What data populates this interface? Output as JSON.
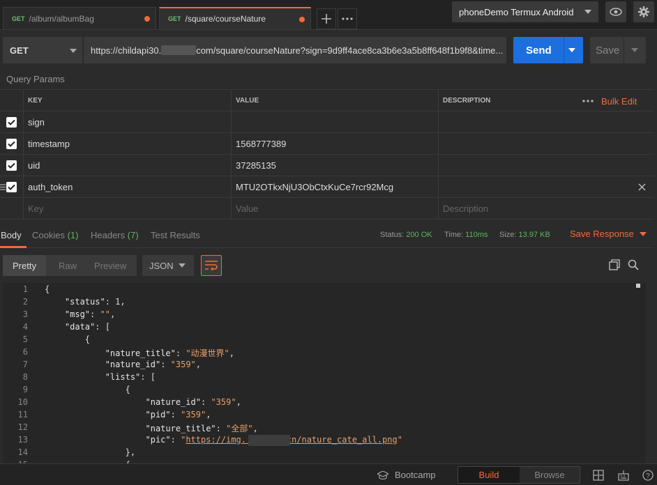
{
  "tabs": [
    {
      "method": "GET",
      "label": "/album/albumBag",
      "unsaved": true
    },
    {
      "method": "GET",
      "label": "/square/courseNature",
      "unsaved": true,
      "active": true
    }
  ],
  "environment": "phoneDemo Termux Android",
  "request": {
    "method": "GET",
    "url_prefix": "https://childapi30.",
    "url_suffix": "com/square/courseNature?sign=9d9ff4ace8ca3b6e3a5b8ff648f1b9f8&time...",
    "send_label": "Send",
    "save_label": "Save"
  },
  "query_params": {
    "title": "Query Params",
    "headers": {
      "key": "KEY",
      "value": "VALUE",
      "description": "DESCRIPTION",
      "bulk_edit": "Bulk Edit"
    },
    "rows": [
      {
        "key": "sign",
        "value": "9d9ff4ace8ca3b6e3a5b8ff648f1b9f8",
        "checked": true
      },
      {
        "key": "timestamp",
        "value": "1568777389",
        "checked": true
      },
      {
        "key": "uid",
        "value": "37285135",
        "checked": true
      },
      {
        "key": "auth_token",
        "value": "MTU2OTkxNjU3ObCtxKuCe7rcr92Mcg",
        "checked": true
      }
    ],
    "placeholders": {
      "key": "Key",
      "value": "Value",
      "description": "Description"
    }
  },
  "response": {
    "tabs": {
      "body": "Body",
      "cookies": "Cookies",
      "cookies_count": "(1)",
      "headers": "Headers",
      "headers_count": "(7)",
      "tests": "Test Results"
    },
    "status_label": "Status:",
    "status": "200 OK",
    "time_label": "Time:",
    "time": "110ms",
    "size_label": "Size:",
    "size": "13.97 KB",
    "save_response": "Save Response",
    "formats": {
      "pretty": "Pretty",
      "raw": "Raw",
      "preview": "Preview"
    },
    "lang": "JSON"
  },
  "code_lines": [
    {
      "n": "1",
      "t": "{"
    },
    {
      "n": "2",
      "t": "    \"status\": 1,"
    },
    {
      "n": "3",
      "t": "    \"msg\": \"\","
    },
    {
      "n": "4",
      "t": "    \"data\": ["
    },
    {
      "n": "5",
      "t": "        {"
    },
    {
      "n": "6",
      "t": "            \"nature_title\": \"动漫世界\","
    },
    {
      "n": "7",
      "t": "            \"nature_id\": \"359\","
    },
    {
      "n": "8",
      "t": "            \"lists\": ["
    },
    {
      "n": "9",
      "t": "                {"
    },
    {
      "n": "10",
      "t": "                    \"nature_id\": \"359\","
    },
    {
      "n": "11",
      "t": "                    \"pid\": \"359\","
    },
    {
      "n": "12",
      "t": "                    \"nature_title\": \"全部\","
    },
    {
      "n": "13",
      "t": "                    \"pic\": \"https://img.        cn/nature_cate_all.png\""
    },
    {
      "n": "14",
      "t": "                },"
    },
    {
      "n": "15",
      "t": "                {"
    }
  ],
  "bottom": {
    "bootcamp": "Bootcamp",
    "build": "Build",
    "browse": "Browse"
  },
  "colors": {
    "accent": "#f26b3a",
    "send": "#1d6fe0",
    "ok": "#5fb35f"
  }
}
